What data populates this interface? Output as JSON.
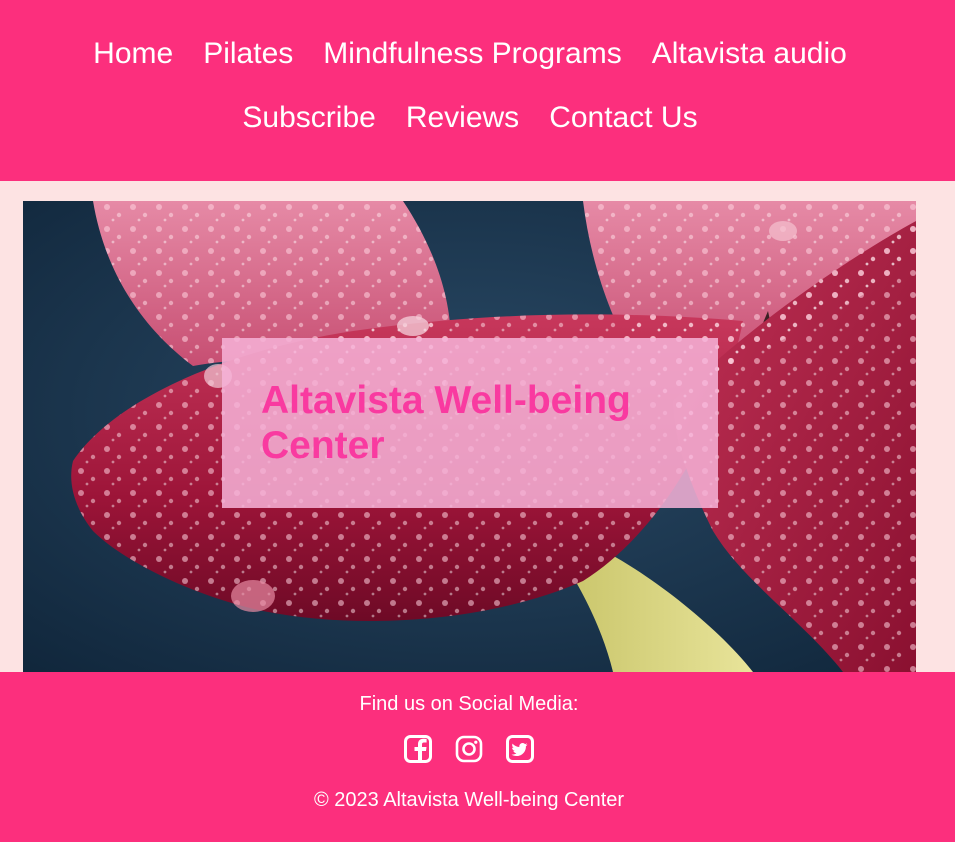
{
  "nav": {
    "row1": [
      "Home",
      "Pilates",
      "Mindfulness Programs",
      "Altavista audio"
    ],
    "row2": [
      "Subscribe",
      "Reviews",
      "Contact Us"
    ]
  },
  "hero": {
    "title": "Altavista Well-being Center",
    "image": "red tulip petals with water droplets on dark blue background"
  },
  "footer": {
    "social_heading": "Find us on Social Media:",
    "icons": [
      "facebook-icon",
      "instagram-icon",
      "twitter-icon"
    ],
    "copyright": "© 2023 Altavista Well-being Center"
  },
  "colors": {
    "brand": "#fc2f7d",
    "page_bg": "#fde3e3",
    "title": "#f93aa0",
    "title_box": "#f6b2d7"
  }
}
